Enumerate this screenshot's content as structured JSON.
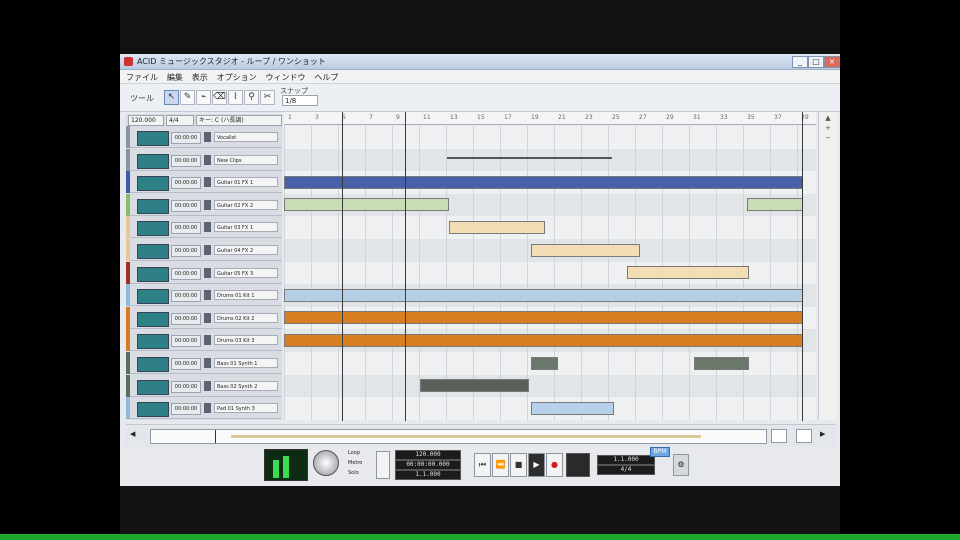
{
  "window": {
    "title": "ACID ミュージックスタジオ - ループ / ワンショット",
    "controls": [
      "_",
      "□",
      "×"
    ]
  },
  "menu": [
    "ファイル",
    "編集",
    "表示",
    "オプション",
    "ウィンドウ",
    "ヘルプ"
  ],
  "toolbar": {
    "label": "ツール",
    "tools": [
      "draw-icon",
      "select-icon",
      "pencil-icon",
      "paint-icon",
      "erase-icon",
      "zoom-icon",
      "scissor-icon"
    ],
    "snap_label": "スナップ",
    "snap_value": "1/8"
  },
  "header_row": {
    "tempo": "120.000",
    "key": "4/4",
    "signature": "キー: C (ハ長調)"
  },
  "ruler_ticks": [
    "1",
    "3",
    "5",
    "7",
    "9",
    "11",
    "13",
    "15",
    "17",
    "19",
    "21",
    "23",
    "25",
    "27",
    "29",
    "31",
    "33",
    "35",
    "37",
    "39"
  ],
  "tracks": [
    {
      "num": "00:00:00",
      "name": "Vocalist",
      "color": "#8a93a2"
    },
    {
      "num": "00:00:00",
      "name": "New Clips",
      "color": "#8a93a2"
    },
    {
      "num": "00:00:00",
      "name": "Guitar 01 FX 1",
      "color": "#3f5aa8"
    },
    {
      "num": "00:00:00",
      "name": "Guitar 02 FX 2",
      "color": "#8dbb6e"
    },
    {
      "num": "00:00:00",
      "name": "Guitar 03 FX 1",
      "color": "#e6c79a"
    },
    {
      "num": "00:00:00",
      "name": "Guitar 04 FX 2",
      "color": "#e6c79a"
    },
    {
      "num": "00:00:00",
      "name": "Guitar 05 FX 3",
      "color": "#9c3324"
    },
    {
      "num": "00:00:00",
      "name": "Drums 01 Kit 1",
      "color": "#8fb8d9"
    },
    {
      "num": "00:00:00",
      "name": "Drums 02 Kit 2",
      "color": "#d77a21"
    },
    {
      "num": "00:00:00",
      "name": "Drums 03 Kit 3",
      "color": "#d77a21"
    },
    {
      "num": "00:00:00",
      "name": "Bass 01 Synth 1",
      "color": "#5e6e5e"
    },
    {
      "num": "00:00:00",
      "name": "Bass 02 Synth 2",
      "color": "#5e6e5e"
    },
    {
      "num": "00:00:00",
      "name": "Pad 01 Synth 3",
      "color": "#8fb8d9"
    }
  ],
  "clips": [
    {
      "row": 2,
      "start": 0.0,
      "end": 0.975,
      "color": "#4661a9"
    },
    {
      "row": 3,
      "start": 0.0,
      "end": 0.31,
      "color": "#c9deb4"
    },
    {
      "row": 3,
      "start": 0.87,
      "end": 0.975,
      "color": "#c9deb4"
    },
    {
      "row": 4,
      "start": 0.31,
      "end": 0.49,
      "color": "#f3ddb5"
    },
    {
      "row": 5,
      "start": 0.465,
      "end": 0.67,
      "color": "#f3ddb5"
    },
    {
      "row": 6,
      "start": 0.645,
      "end": 0.875,
      "color": "#f3ddb5"
    },
    {
      "row": 7,
      "start": 0.0,
      "end": 0.975,
      "color": "#b5d0e6"
    },
    {
      "row": 8,
      "start": 0.0,
      "end": 0.975,
      "color": "#d77d22"
    },
    {
      "row": 9,
      "start": 0.0,
      "end": 0.975,
      "color": "#d77d22"
    },
    {
      "row": 10,
      "start": 0.465,
      "end": 0.515,
      "color": "#6b776b"
    },
    {
      "row": 10,
      "start": 0.77,
      "end": 0.875,
      "color": "#6b776b"
    },
    {
      "row": 11,
      "start": 0.255,
      "end": 0.46,
      "color": "#5a605a"
    },
    {
      "row": 12,
      "start": 0.465,
      "end": 0.62,
      "color": "#b8d1ea"
    }
  ],
  "transport": {
    "tempo_lcd": "120.000",
    "time_lcd": "00:00:00.000",
    "bar_lcd": "1.1.000",
    "checkbox_labels": [
      "Loop",
      "Metro",
      "Solo"
    ],
    "buttons": [
      "rewind-icon",
      "back-icon",
      "stop-icon",
      "play-icon",
      "record-icon"
    ],
    "right_lcd": "1.1.000",
    "right_lcd_2": "4/4",
    "blue_tag": "BPM"
  }
}
